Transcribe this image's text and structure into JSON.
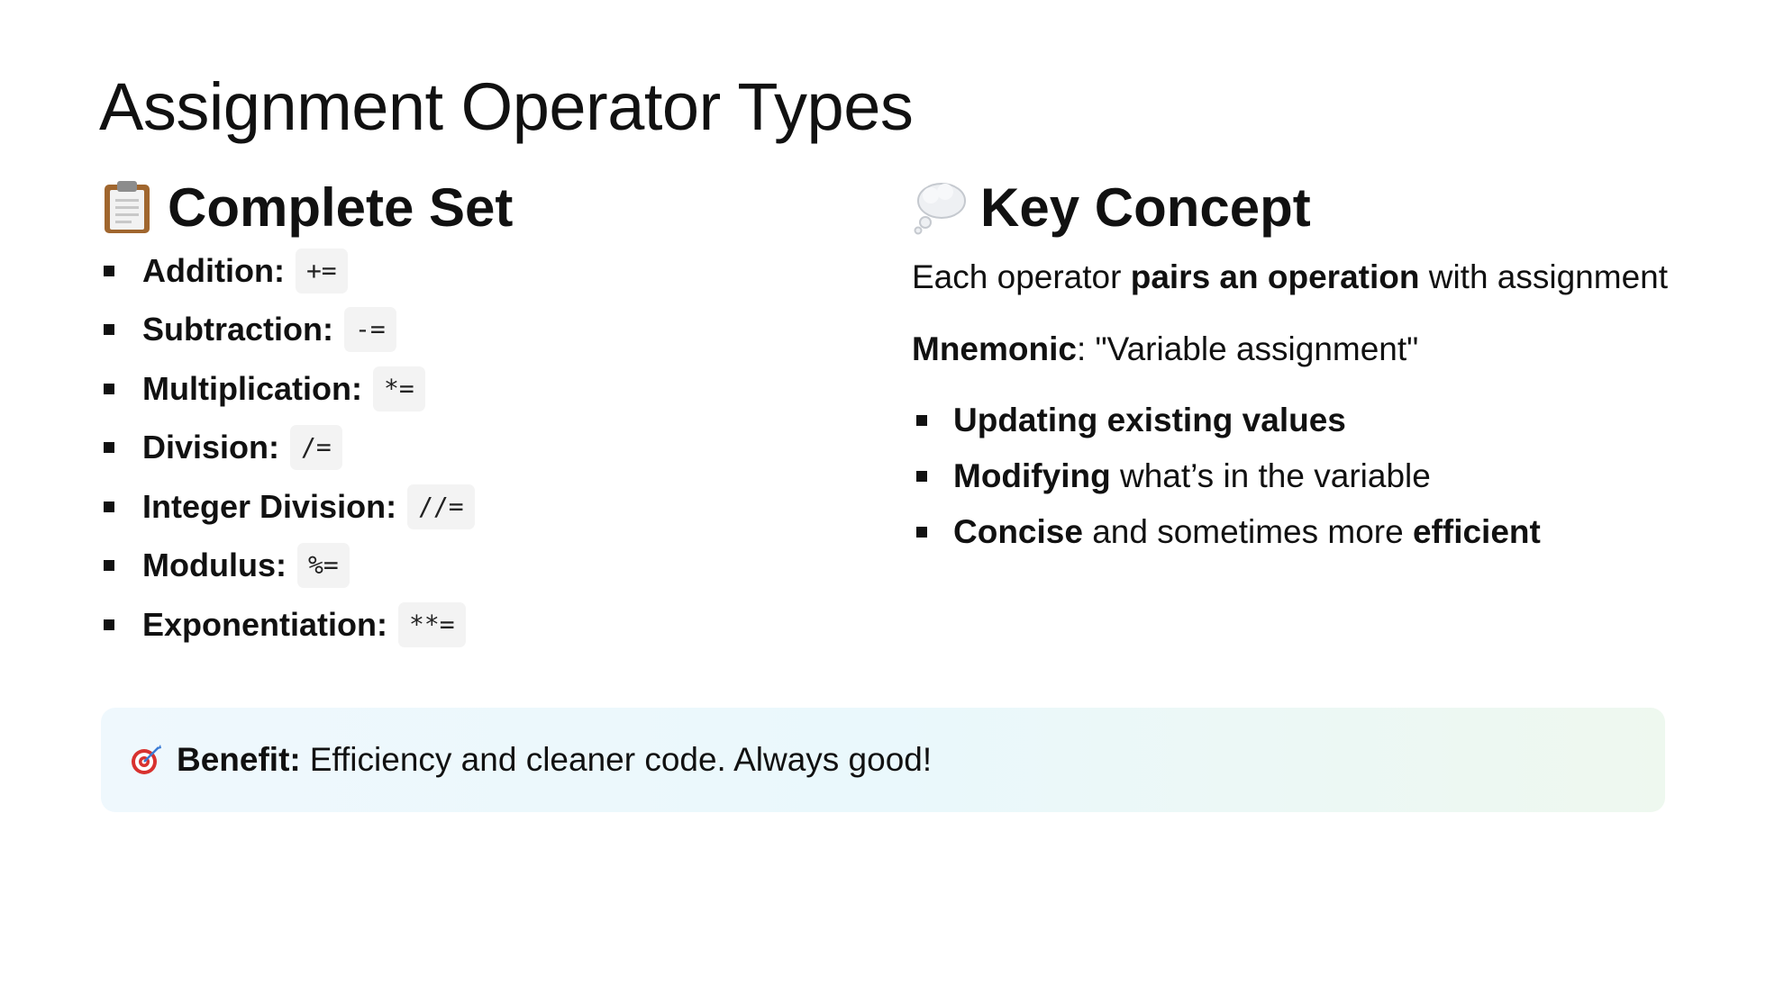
{
  "title": "Assignment Operator Types",
  "left": {
    "heading": "Complete Set",
    "heading_icon": "clipboard-icon",
    "operators": [
      {
        "name": "Addition",
        "code": "+="
      },
      {
        "name": "Subtraction",
        "code": "-="
      },
      {
        "name": "Multiplication",
        "code": "*="
      },
      {
        "name": "Division",
        "code": "/="
      },
      {
        "name": "Integer Division",
        "code": "//="
      },
      {
        "name": "Modulus",
        "code": "%="
      },
      {
        "name": "Exponentiation",
        "code": "**="
      }
    ]
  },
  "right": {
    "heading": "Key Concept",
    "heading_icon": "thought-bubble-icon",
    "para1": {
      "pre": "Each operator ",
      "bold": "pairs an operation",
      "post": " with assignment"
    },
    "mnemonic": {
      "label": "Mnemonic",
      "text": ": \"Variable assignment\""
    },
    "points": [
      {
        "bold": "Updating existing values",
        "rest": "",
        "bold2": ""
      },
      {
        "bold": "Modifying",
        "rest": " what’s in the variable",
        "bold2": ""
      },
      {
        "bold": "Concise",
        "rest": " and sometimes more ",
        "bold2": "efficient"
      }
    ]
  },
  "callout": {
    "icon": "target-icon",
    "label": "Benefit:",
    "text": "Efficiency and cleaner code. Always good!"
  },
  "colors": {
    "text": "#111111",
    "code_bg": "#f3f3f3",
    "callout_start": "#eff8fd",
    "callout_end": "#eef8ef"
  }
}
